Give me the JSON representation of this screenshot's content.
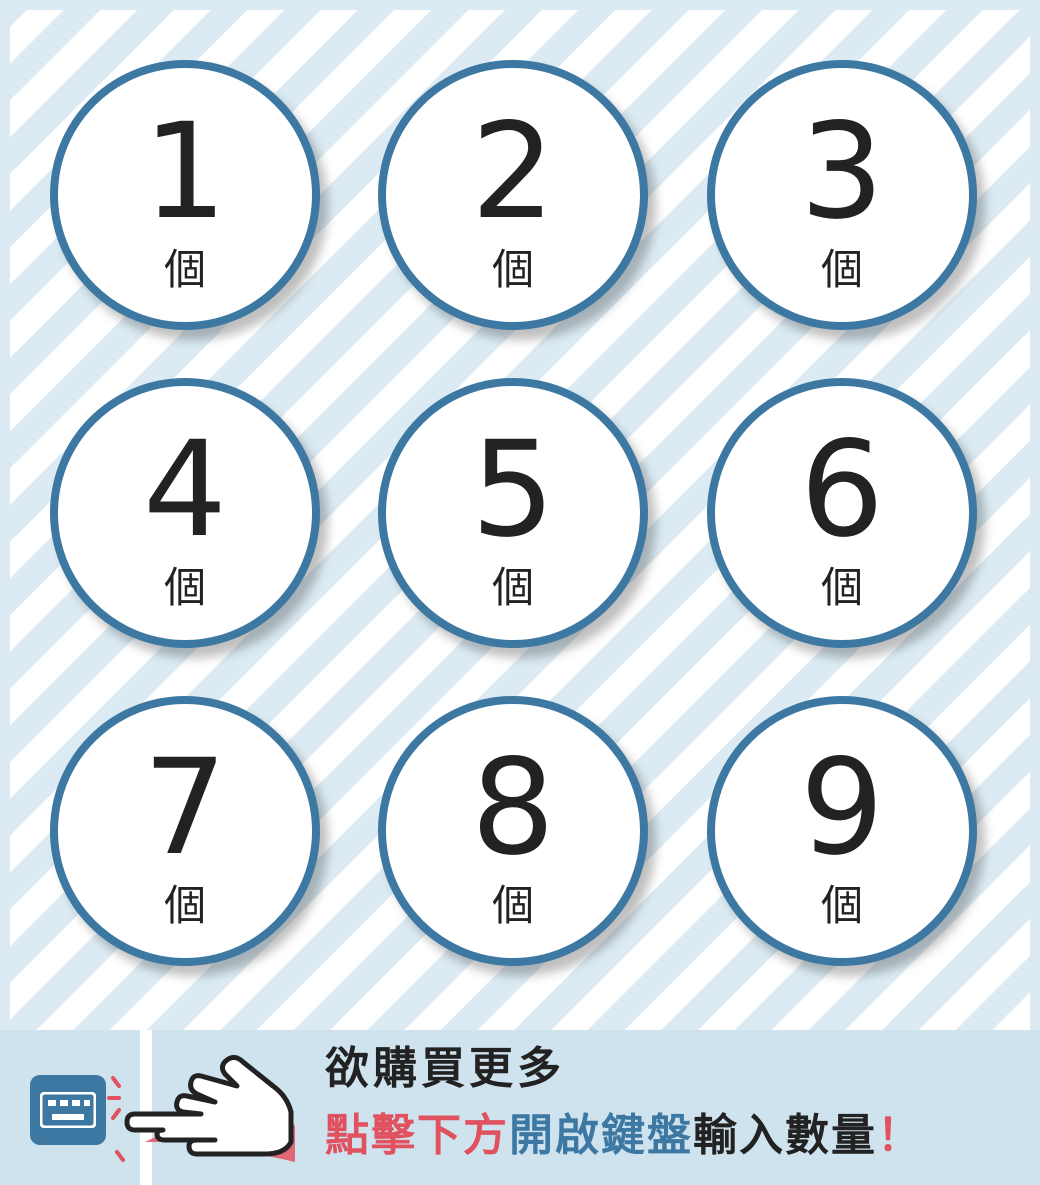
{
  "buttons": [
    {
      "number": "1",
      "unit": "個"
    },
    {
      "number": "2",
      "unit": "個"
    },
    {
      "number": "3",
      "unit": "個"
    },
    {
      "number": "4",
      "unit": "個"
    },
    {
      "number": "5",
      "unit": "個"
    },
    {
      "number": "6",
      "unit": "個"
    },
    {
      "number": "7",
      "unit": "個"
    },
    {
      "number": "8",
      "unit": "個"
    },
    {
      "number": "9",
      "unit": "個"
    }
  ],
  "banner": {
    "line1": "欲購買更多",
    "line2_part1": "點擊下方",
    "line2_part2": "開啟鍵盤",
    "line2_part3": "輸入數量",
    "line2_part4": "！",
    "icons": [
      "keyboard-icon",
      "pointing-hand-icon"
    ]
  },
  "colors": {
    "accent_blue": "#3d78a3",
    "accent_red": "#e0525f",
    "stripe_light": "#dcebf3",
    "banner_bg": "#cfe3ee"
  }
}
